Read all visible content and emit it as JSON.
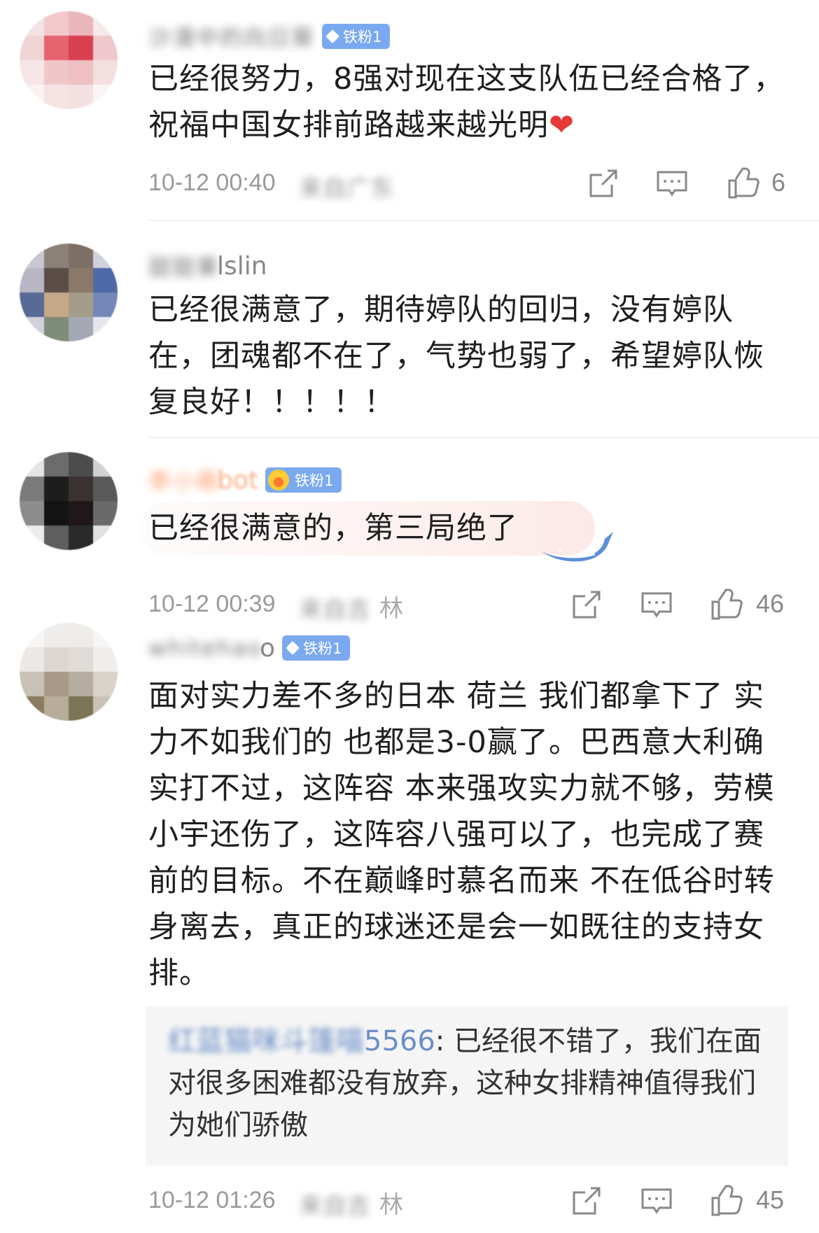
{
  "comments": [
    {
      "user": {
        "name": "沙漠中的向日葵",
        "badge": "铁粉1"
      },
      "text": "已经很努力，8强对现在这支队伍已经合格了，祝福中国女排前路越来越光明",
      "time": "10-12 00:40",
      "location": "来自广东",
      "likes": "6"
    },
    {
      "user": {
        "name": "甜甜果",
        "name_tail": "lslin"
      },
      "text": "已经很满意了，期待婷队的回归，没有婷队在，团魂都不在了，气势也弱了，希望婷队恢复良好！！！！！"
    },
    {
      "user": {
        "name": "李小萌",
        "name_tail": "bot",
        "badge": "铁粉1"
      },
      "text": "已经很满意的，第三局绝了",
      "time": "10-12 00:39",
      "location": "来自吉",
      "location_tail": "林",
      "likes": "46"
    },
    {
      "user": {
        "name": "whitehao",
        "name_tail": "o",
        "badge": "铁粉1"
      },
      "text": "面对实力差不多的日本 荷兰 我们都拿下了 实力不如我们的 也都是3-0赢了。巴西意大利确实打不过，这阵容 本来强攻实力就不够，劳模小宇还伤了，这阵容八强可以了，也完成了赛前的目标。不在巅峰时慕名而来 不在低谷时转身离去，真正的球迷还是会一如既往的支持女排。",
      "reply": {
        "user": "红蓝猫咪斗篷喵",
        "user_tail": "5566",
        "text": "已经很不错了，我们在面对很多困难都没有放弃，这种女排精神值得我们为她们骄傲"
      },
      "time": "10-12 01:26",
      "location": "来自吉",
      "location_tail": "林",
      "likes": "45"
    }
  ],
  "icons": [
    "share-icon",
    "comment-icon",
    "like-icon"
  ],
  "colors": {
    "badge": "#7aa9f0",
    "heart": "#e53935",
    "reply_bg": "#f5f5f5",
    "meta": "#9a9a9a"
  }
}
